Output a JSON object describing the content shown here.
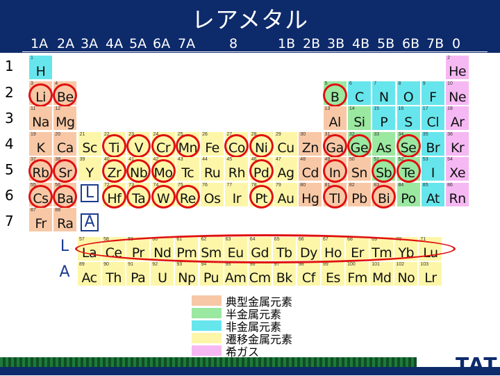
{
  "title": "レアメタル",
  "groups": [
    "1A",
    "2A",
    "3A",
    "4A",
    "5A",
    "6A",
    "7A",
    "8",
    "1B",
    "2B",
    "3B",
    "4B",
    "5B",
    "6B",
    "7B",
    "0"
  ],
  "periods": [
    "1",
    "2",
    "3",
    "4",
    "5",
    "6",
    "7"
  ],
  "series_labels": {
    "L": "L",
    "A": "A"
  },
  "legend": [
    {
      "color": "#f8c8a6",
      "label": "典型金属元素"
    },
    {
      "color": "#9be8a0",
      "label": "半金属元素"
    },
    {
      "color": "#66e6ec",
      "label": "非金属元素"
    },
    {
      "color": "#fdf6a8",
      "label": "遷移金属元素"
    },
    {
      "color": "#f6b8f3",
      "label": "希ガス"
    }
  ],
  "logo": "TAT",
  "elements": [
    {
      "n": "1",
      "s": "H",
      "t": "non",
      "col": 0,
      "row": 0,
      "ring": false
    },
    {
      "n": "2",
      "s": "He",
      "t": "noble",
      "col": 17,
      "row": 0,
      "ring": false
    },
    {
      "n": "3",
      "s": "Li",
      "t": "typ",
      "col": 0,
      "row": 1,
      "ring": true
    },
    {
      "n": "4",
      "s": "Be",
      "t": "typ",
      "col": 1,
      "row": 1,
      "ring": true
    },
    {
      "n": "5",
      "s": "B",
      "t": "semi",
      "col": 12,
      "row": 1,
      "ring": true
    },
    {
      "n": "6",
      "s": "C",
      "t": "non",
      "col": 13,
      "row": 1,
      "ring": false
    },
    {
      "n": "7",
      "s": "N",
      "t": "non",
      "col": 14,
      "row": 1,
      "ring": false
    },
    {
      "n": "8",
      "s": "O",
      "t": "non",
      "col": 15,
      "row": 1,
      "ring": false
    },
    {
      "n": "9",
      "s": "F",
      "t": "non",
      "col": 16,
      "row": 1,
      "ring": false
    },
    {
      "n": "10",
      "s": "Ne",
      "t": "noble",
      "col": 17,
      "row": 1,
      "ring": false
    },
    {
      "n": "11",
      "s": "Na",
      "t": "typ",
      "col": 0,
      "row": 2,
      "ring": false
    },
    {
      "n": "12",
      "s": "Mg",
      "t": "typ",
      "col": 1,
      "row": 2,
      "ring": false
    },
    {
      "n": "13",
      "s": "Al",
      "t": "typ",
      "col": 12,
      "row": 2,
      "ring": false
    },
    {
      "n": "14",
      "s": "Si",
      "t": "semi",
      "col": 13,
      "row": 2,
      "ring": false
    },
    {
      "n": "15",
      "s": "P",
      "t": "non",
      "col": 14,
      "row": 2,
      "ring": false
    },
    {
      "n": "16",
      "s": "S",
      "t": "non",
      "col": 15,
      "row": 2,
      "ring": false
    },
    {
      "n": "17",
      "s": "Cl",
      "t": "non",
      "col": 16,
      "row": 2,
      "ring": false
    },
    {
      "n": "18",
      "s": "Ar",
      "t": "noble",
      "col": 17,
      "row": 2,
      "ring": false
    },
    {
      "n": "19",
      "s": "K",
      "t": "typ",
      "col": 0,
      "row": 3,
      "ring": false
    },
    {
      "n": "20",
      "s": "Ca",
      "t": "typ",
      "col": 1,
      "row": 3,
      "ring": false
    },
    {
      "n": "21",
      "s": "Sc",
      "t": "trans",
      "col": 2,
      "row": 3,
      "ring": false
    },
    {
      "n": "22",
      "s": "Ti",
      "t": "trans",
      "col": 3,
      "row": 3,
      "ring": true
    },
    {
      "n": "23",
      "s": "V",
      "t": "trans",
      "col": 4,
      "row": 3,
      "ring": true
    },
    {
      "n": "24",
      "s": "Cr",
      "t": "trans",
      "col": 5,
      "row": 3,
      "ring": true
    },
    {
      "n": "25",
      "s": "Mn",
      "t": "trans",
      "col": 6,
      "row": 3,
      "ring": true
    },
    {
      "n": "26",
      "s": "Fe",
      "t": "trans",
      "col": 7,
      "row": 3,
      "ring": false
    },
    {
      "n": "27",
      "s": "Co",
      "t": "trans",
      "col": 8,
      "row": 3,
      "ring": true
    },
    {
      "n": "28",
      "s": "Ni",
      "t": "trans",
      "col": 9,
      "row": 3,
      "ring": true
    },
    {
      "n": "29",
      "s": "Cu",
      "t": "trans",
      "col": 10,
      "row": 3,
      "ring": false
    },
    {
      "n": "30",
      "s": "Zn",
      "t": "typ",
      "col": 11,
      "row": 3,
      "ring": false
    },
    {
      "n": "31",
      "s": "Ga",
      "t": "typ",
      "col": 12,
      "row": 3,
      "ring": true
    },
    {
      "n": "32",
      "s": "Ge",
      "t": "semi",
      "col": 13,
      "row": 3,
      "ring": true
    },
    {
      "n": "33",
      "s": "As",
      "t": "semi",
      "col": 14,
      "row": 3,
      "ring": false
    },
    {
      "n": "34",
      "s": "Se",
      "t": "semi",
      "col": 15,
      "row": 3,
      "ring": true
    },
    {
      "n": "35",
      "s": "Br",
      "t": "non",
      "col": 16,
      "row": 3,
      "ring": false
    },
    {
      "n": "36",
      "s": "Kr",
      "t": "noble",
      "col": 17,
      "row": 3,
      "ring": false
    },
    {
      "n": "37",
      "s": "Rb",
      "t": "typ",
      "col": 0,
      "row": 4,
      "ring": true
    },
    {
      "n": "38",
      "s": "Sr",
      "t": "typ",
      "col": 1,
      "row": 4,
      "ring": true
    },
    {
      "n": "39",
      "s": "Y",
      "t": "trans",
      "col": 2,
      "row": 4,
      "ring": false
    },
    {
      "n": "40",
      "s": "Zr",
      "t": "trans",
      "col": 3,
      "row": 4,
      "ring": true
    },
    {
      "n": "41",
      "s": "Nb",
      "t": "trans",
      "col": 4,
      "row": 4,
      "ring": true
    },
    {
      "n": "42",
      "s": "Mo",
      "t": "trans",
      "col": 5,
      "row": 4,
      "ring": true
    },
    {
      "n": "43",
      "s": "Tc",
      "t": "trans",
      "col": 6,
      "row": 4,
      "ring": false
    },
    {
      "n": "44",
      "s": "Ru",
      "t": "trans",
      "col": 7,
      "row": 4,
      "ring": false
    },
    {
      "n": "45",
      "s": "Rh",
      "t": "trans",
      "col": 8,
      "row": 4,
      "ring": false
    },
    {
      "n": "46",
      "s": "Pd",
      "t": "trans",
      "col": 9,
      "row": 4,
      "ring": true
    },
    {
      "n": "47",
      "s": "Ag",
      "t": "trans",
      "col": 10,
      "row": 4,
      "ring": false
    },
    {
      "n": "48",
      "s": "Cd",
      "t": "typ",
      "col": 11,
      "row": 4,
      "ring": false
    },
    {
      "n": "49",
      "s": "In",
      "t": "typ",
      "col": 12,
      "row": 4,
      "ring": true
    },
    {
      "n": "50",
      "s": "Sn",
      "t": "typ",
      "col": 13,
      "row": 4,
      "ring": false
    },
    {
      "n": "51",
      "s": "Sb",
      "t": "semi",
      "col": 14,
      "row": 4,
      "ring": true
    },
    {
      "n": "52",
      "s": "Te",
      "t": "semi",
      "col": 15,
      "row": 4,
      "ring": true
    },
    {
      "n": "53",
      "s": "I",
      "t": "non",
      "col": 16,
      "row": 4,
      "ring": false
    },
    {
      "n": "54",
      "s": "Xe",
      "t": "noble",
      "col": 17,
      "row": 4,
      "ring": false
    },
    {
      "n": "55",
      "s": "Cs",
      "t": "typ",
      "col": 0,
      "row": 5,
      "ring": true
    },
    {
      "n": "56",
      "s": "Ba",
      "t": "typ",
      "col": 1,
      "row": 5,
      "ring": true
    },
    {
      "n": "72",
      "s": "Hf",
      "t": "trans",
      "col": 3,
      "row": 5,
      "ring": true
    },
    {
      "n": "73",
      "s": "Ta",
      "t": "trans",
      "col": 4,
      "row": 5,
      "ring": true
    },
    {
      "n": "74",
      "s": "W",
      "t": "trans",
      "col": 5,
      "row": 5,
      "ring": true
    },
    {
      "n": "75",
      "s": "Re",
      "t": "trans",
      "col": 6,
      "row": 5,
      "ring": true
    },
    {
      "n": "76",
      "s": "Os",
      "t": "trans",
      "col": 7,
      "row": 5,
      "ring": false
    },
    {
      "n": "77",
      "s": "Ir",
      "t": "trans",
      "col": 8,
      "row": 5,
      "ring": false
    },
    {
      "n": "78",
      "s": "Pt",
      "t": "trans",
      "col": 9,
      "row": 5,
      "ring": true
    },
    {
      "n": "79",
      "s": "Au",
      "t": "trans",
      "col": 10,
      "row": 5,
      "ring": false
    },
    {
      "n": "80",
      "s": "Hg",
      "t": "typ",
      "col": 11,
      "row": 5,
      "ring": false
    },
    {
      "n": "81",
      "s": "Tl",
      "t": "typ",
      "col": 12,
      "row": 5,
      "ring": true
    },
    {
      "n": "82",
      "s": "Pb",
      "t": "typ",
      "col": 13,
      "row": 5,
      "ring": false
    },
    {
      "n": "83",
      "s": "Bi",
      "t": "typ",
      "col": 14,
      "row": 5,
      "ring": true
    },
    {
      "n": "84",
      "s": "Po",
      "t": "semi",
      "col": 15,
      "row": 5,
      "ring": false
    },
    {
      "n": "85",
      "s": "At",
      "t": "non",
      "col": 16,
      "row": 5,
      "ring": false
    },
    {
      "n": "86",
      "s": "Rn",
      "t": "noble",
      "col": 17,
      "row": 5,
      "ring": false
    },
    {
      "n": "87",
      "s": "Fr",
      "t": "typ",
      "col": 0,
      "row": 6,
      "ring": false
    },
    {
      "n": "88",
      "s": "Ra",
      "t": "typ",
      "col": 1,
      "row": 6,
      "ring": false
    }
  ],
  "lanthanides": [
    {
      "n": "57",
      "s": "La"
    },
    {
      "n": "58",
      "s": "Ce"
    },
    {
      "n": "59",
      "s": "Pr"
    },
    {
      "n": "60",
      "s": "Nd"
    },
    {
      "n": "61",
      "s": "Pm"
    },
    {
      "n": "62",
      "s": "Sm"
    },
    {
      "n": "63",
      "s": "Eu"
    },
    {
      "n": "64",
      "s": "Gd"
    },
    {
      "n": "65",
      "s": "Tb"
    },
    {
      "n": "66",
      "s": "Dy"
    },
    {
      "n": "67",
      "s": "Ho"
    },
    {
      "n": "68",
      "s": "Er"
    },
    {
      "n": "69",
      "s": "Tm"
    },
    {
      "n": "70",
      "s": "Yb"
    },
    {
      "n": "71",
      "s": "Lu"
    }
  ],
  "actinides": [
    {
      "n": "89",
      "s": "Ac"
    },
    {
      "n": "90",
      "s": "Th"
    },
    {
      "n": "91",
      "s": "Pa"
    },
    {
      "n": "92",
      "s": "U"
    },
    {
      "n": "93",
      "s": "Np"
    },
    {
      "n": "94",
      "s": "Pu"
    },
    {
      "n": "95",
      "s": "Am"
    },
    {
      "n": "96",
      "s": "Cm"
    },
    {
      "n": "97",
      "s": "Bk"
    },
    {
      "n": "98",
      "s": "Cf"
    },
    {
      "n": "99",
      "s": "Es"
    },
    {
      "n": "100",
      "s": "Fm"
    },
    {
      "n": "101",
      "s": "Md"
    },
    {
      "n": "102",
      "s": "No"
    },
    {
      "n": "103",
      "s": "Lr"
    }
  ]
}
